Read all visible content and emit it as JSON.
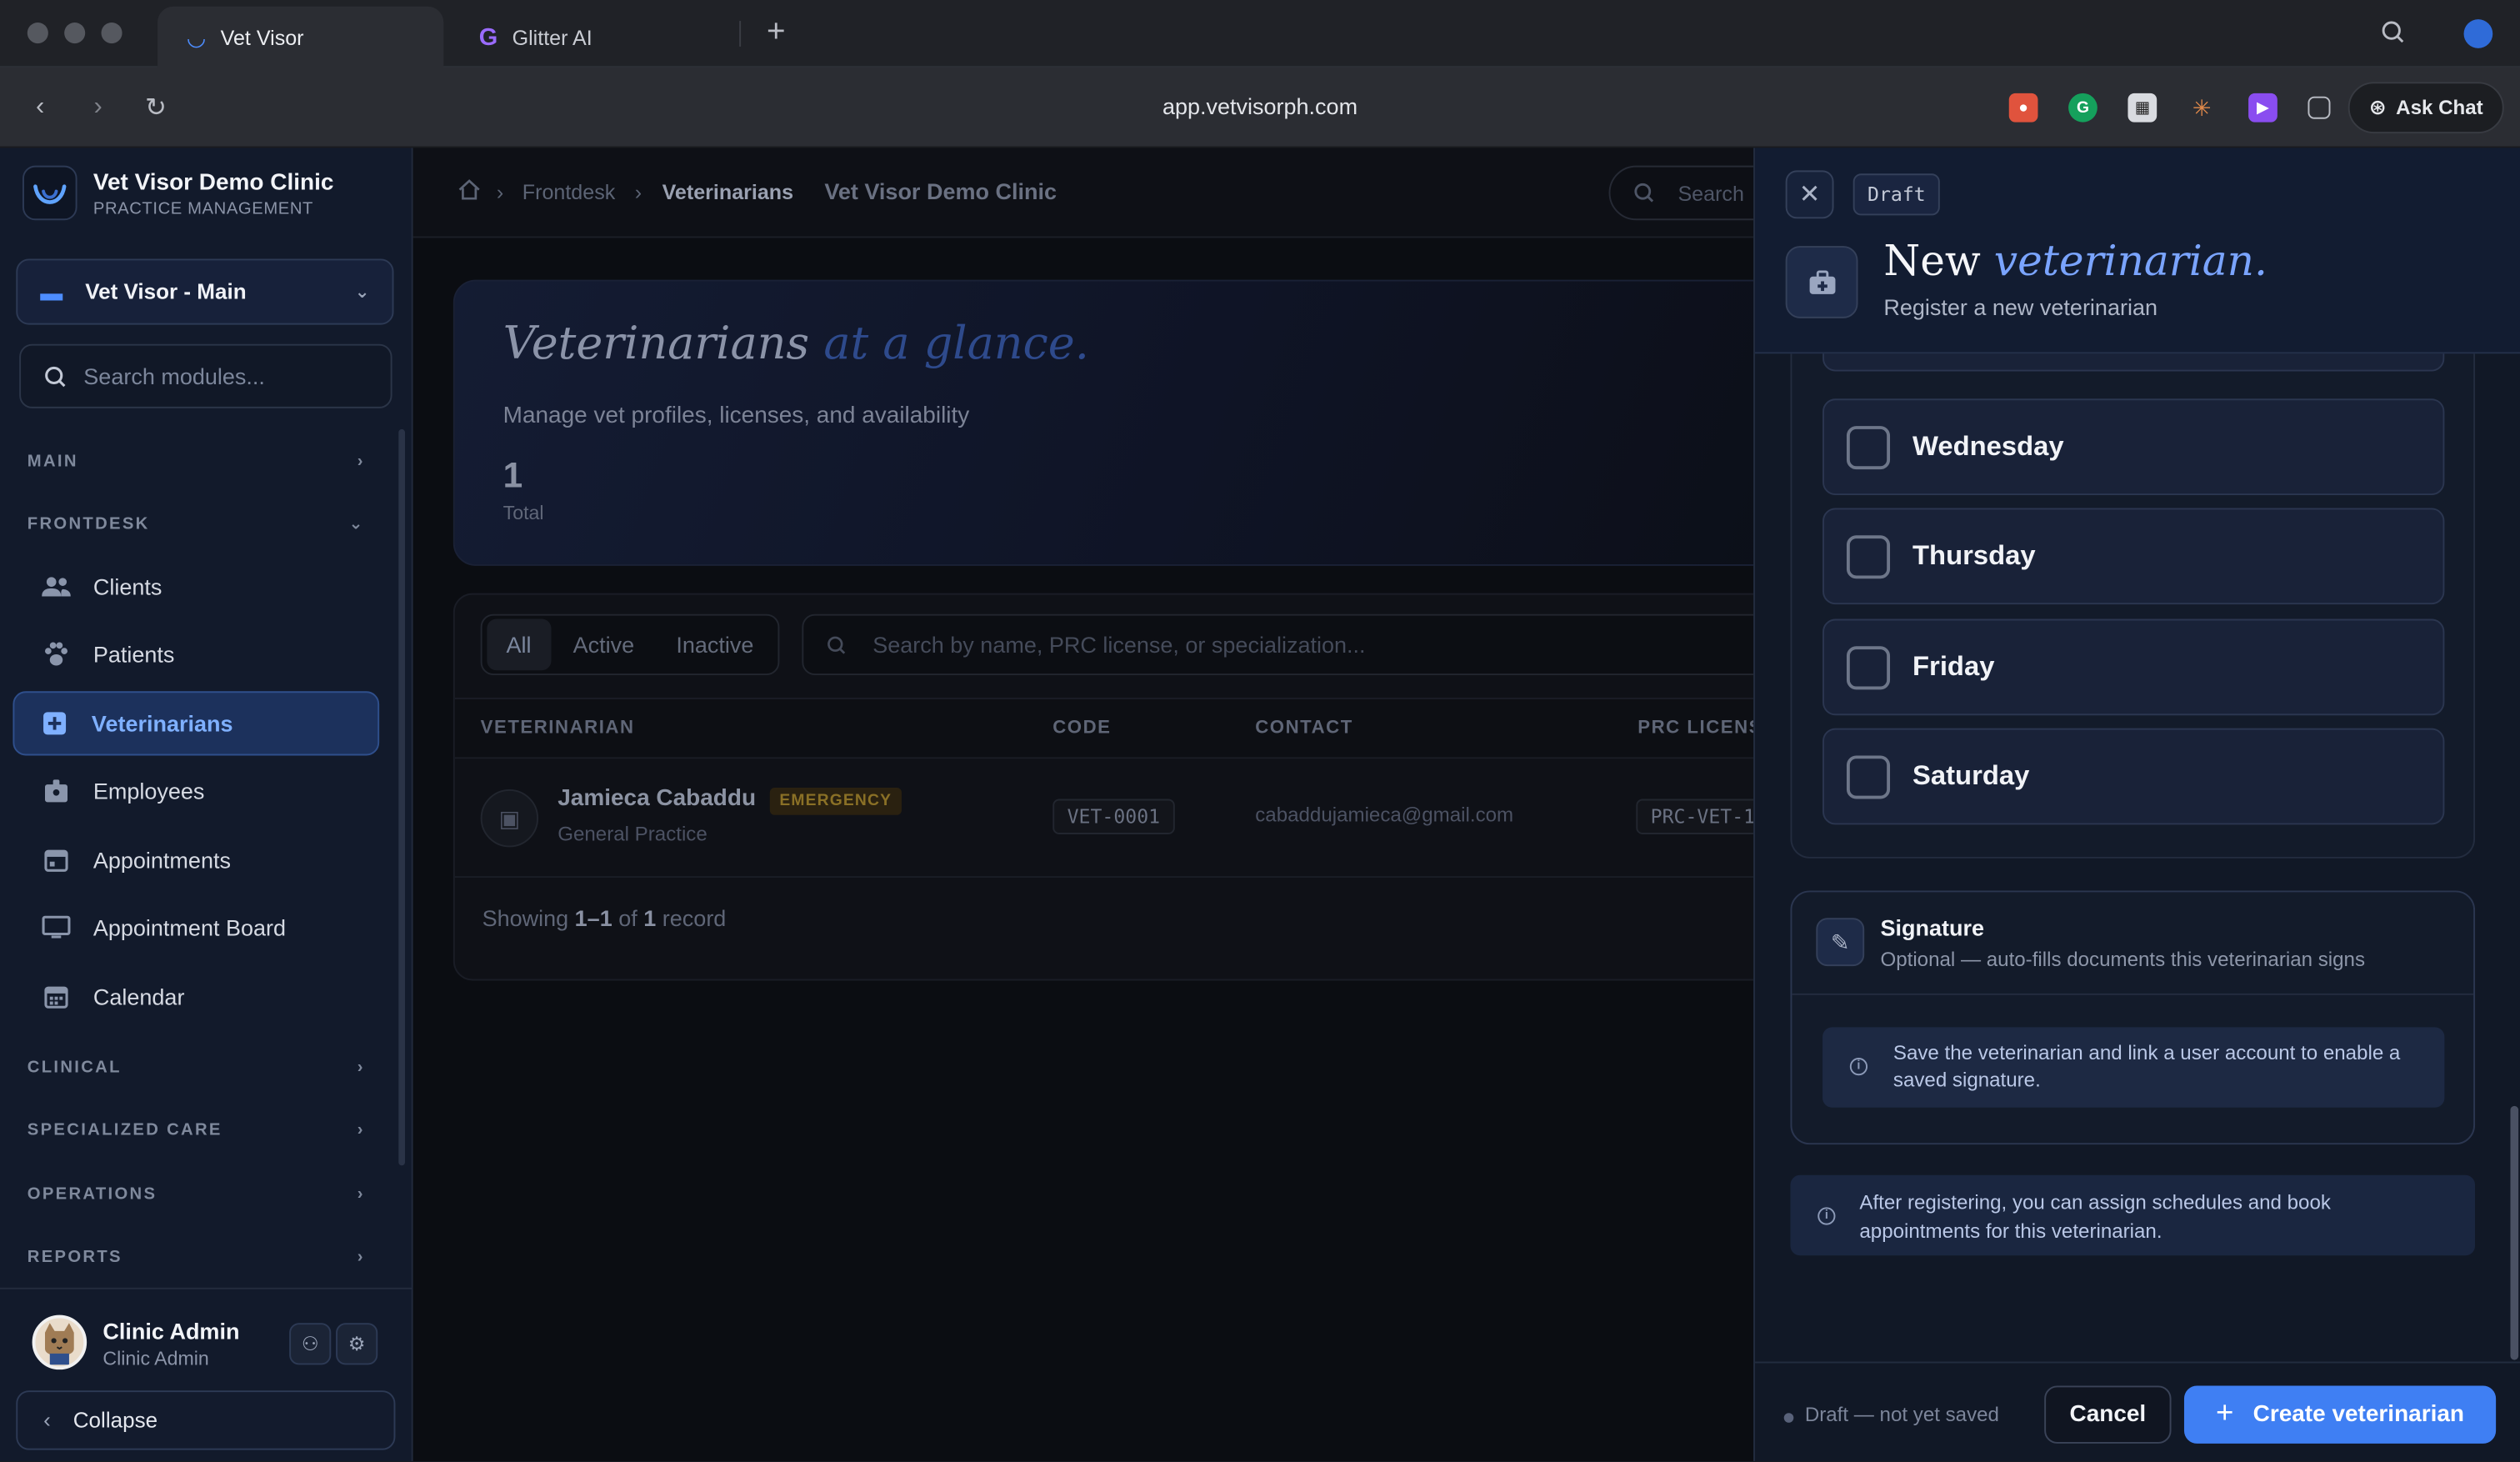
{
  "browser": {
    "tabs": [
      {
        "label": "Vet Visor",
        "active": true
      },
      {
        "label": "Glitter AI",
        "active": false
      }
    ],
    "url": "app.vetvisorph.com",
    "ask_chat": "Ask Chat",
    "icons": [
      "back-icon",
      "forward-icon",
      "reload-icon",
      "search-icon",
      "new-tab-icon"
    ]
  },
  "sidebar": {
    "brand_title": "Vet Visor Demo Clinic",
    "brand_sub": "PRACTICE MANAGEMENT",
    "branch": "Vet Visor - Main",
    "search_placeholder": "Search modules...",
    "sections": {
      "main": "MAIN",
      "frontdesk": "FRONTDESK",
      "clinical": "CLINICAL",
      "specialized": "SPECIALIZED CARE",
      "operations": "OPERATIONS",
      "reports": "REPORTS"
    },
    "items": [
      {
        "label": "Clients",
        "icon": "users-icon"
      },
      {
        "label": "Patients",
        "icon": "paw-icon"
      },
      {
        "label": "Veterinarians",
        "icon": "medical-plus-icon",
        "active": true
      },
      {
        "label": "Employees",
        "icon": "badge-icon"
      },
      {
        "label": "Appointments",
        "icon": "calendar-check-icon"
      },
      {
        "label": "Appointment Board",
        "icon": "monitor-icon"
      },
      {
        "label": "Calendar",
        "icon": "calendar-icon"
      }
    ],
    "user": {
      "name": "Clinic Admin",
      "role": "Clinic Admin"
    },
    "collapse": "Collapse"
  },
  "main": {
    "breadcrumb": {
      "section": "Frontdesk",
      "page": "Veterinarians",
      "clinic": "Vet Visor Demo Clinic"
    },
    "search_placeholder": "Search",
    "hero": {
      "title": "Veterinarians",
      "title_accent": "at a glance.",
      "subtitle": "Manage vet profiles, licenses, and availability",
      "total_value": "1",
      "total_label": "Total"
    },
    "filters": [
      "All",
      "Active",
      "Inactive"
    ],
    "table_search_placeholder": "Search by name, PRC license, or specialization...",
    "columns": [
      "VETERINARIAN",
      "CODE",
      "CONTACT",
      "PRC LICENSE"
    ],
    "rows": [
      {
        "name": "Jamieca Cabaddu",
        "badge": "EMERGENCY",
        "specialization": "General Practice",
        "code": "VET-0001",
        "email": "cabaddujamieca@gmail.com",
        "prc": "PRC-VET-1"
      }
    ],
    "showing": {
      "prefix": "Showing",
      "range": "1–1",
      "of": "of",
      "count": "1",
      "suffix": "record"
    }
  },
  "drawer": {
    "draft_tag": "Draft",
    "title": "New",
    "title_accent": "veterinarian.",
    "subtitle": "Register a new veterinarian",
    "days": [
      "Wednesday",
      "Thursday",
      "Friday",
      "Saturday"
    ],
    "signature": {
      "title": "Signature",
      "subtitle": "Optional — auto-fills documents this veterinarian signs",
      "note": "Save the veterinarian and link a user account to enable a saved signature."
    },
    "after_note": "After registering, you can assign schedules and book appointments for this veterinarian.",
    "footer": {
      "draft_note": "Draft — not yet saved",
      "cancel": "Cancel",
      "create": "Create veterinarian"
    }
  },
  "colors": {
    "accent": "#3f7ff3",
    "active_nav": "#7fb0ff",
    "emergency": "#8a7026"
  }
}
